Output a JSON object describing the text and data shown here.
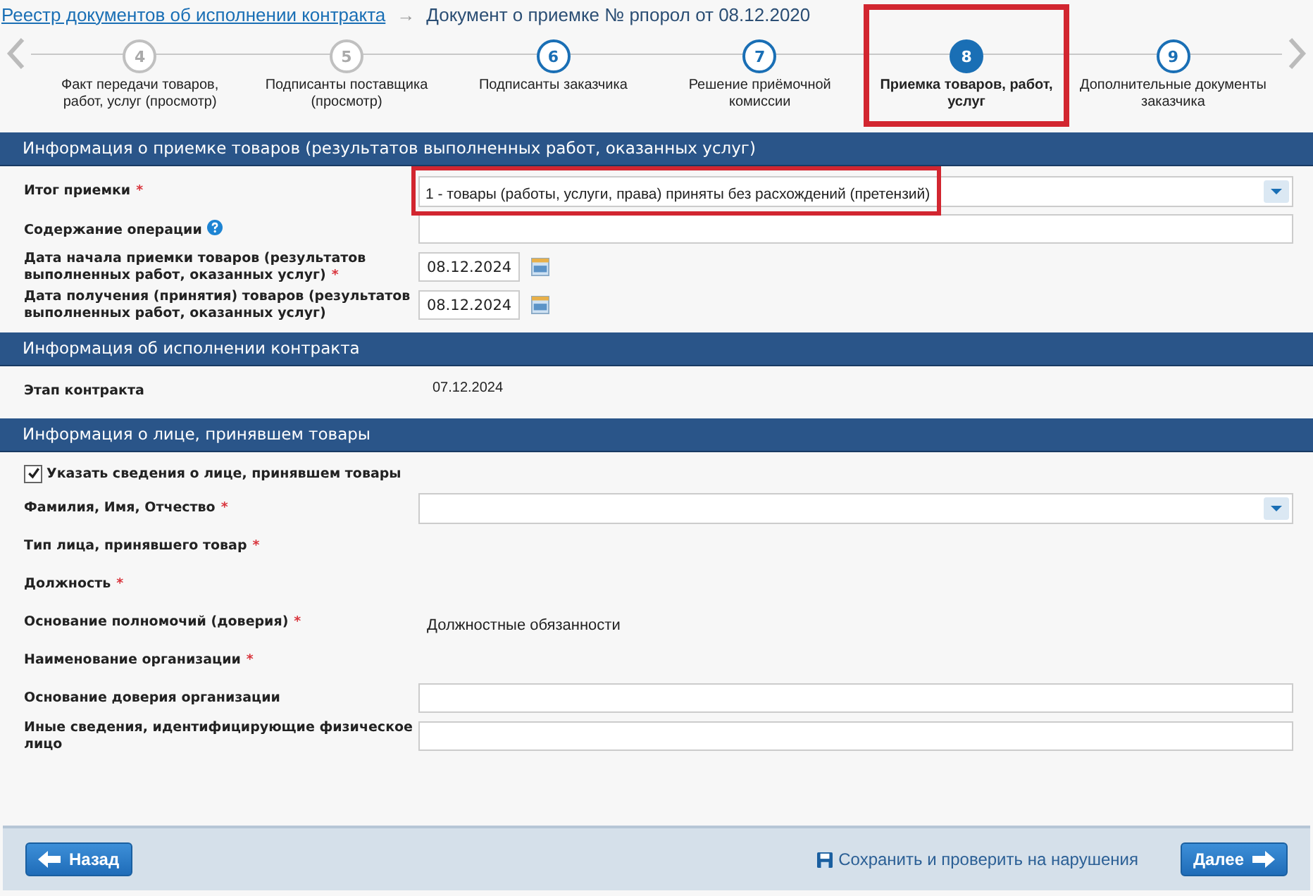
{
  "breadcrumb": {
    "link": "Реестр документов об исполнении контракта",
    "separator": "→",
    "current": "Документ о приемке № рпорол от 08.12.2020"
  },
  "stepper": {
    "steps": [
      {
        "number": "4",
        "label": "Факт передачи товаров, работ, услуг (просмотр)",
        "selected": false,
        "disabled": true,
        "highlighted": false
      },
      {
        "number": "5",
        "label": "Подписанты поставщика (просмотр)",
        "selected": false,
        "disabled": true,
        "highlighted": false
      },
      {
        "number": "6",
        "label": "Подписанты заказчика",
        "selected": false,
        "disabled": false,
        "highlighted": false
      },
      {
        "number": "7",
        "label": "Решение приёмочной комиссии",
        "selected": false,
        "disabled": false,
        "highlighted": false
      },
      {
        "number": "8",
        "label": "Приемка товаров, работ, услуг",
        "selected": true,
        "disabled": false,
        "highlighted": true
      },
      {
        "number": "9",
        "label": "Дополнительные документы заказчика",
        "selected": false,
        "disabled": false,
        "highlighted": false
      }
    ]
  },
  "sections": [
    {
      "title": "Информация о приемке товаров (результатов выполненных работ, оказанных услуг)",
      "rows": [
        {
          "kind": "select",
          "label": "Итог приемки",
          "mark": "*",
          "value": "1 - товары (работы, услуги, права) приняты без расхождений (претензий)",
          "highlighted": true
        },
        {
          "kind": "text",
          "label": "Содержание операции",
          "help": true
        },
        {
          "kind": "date",
          "label": "Дата начала приемки товаров (результатов выполненных работ, оказанных услуг)",
          "mark": "*",
          "value": "08.12.2024"
        },
        {
          "kind": "date",
          "label": "Дата получения (принятия) товаров (результатов выполненных работ, оказанных услуг)",
          "value": "08.12.2024"
        }
      ]
    },
    {
      "title": "Информация об исполнении контракта",
      "rows": [
        {
          "kind": "value",
          "label": "Этап контракта",
          "value": "07.12.2024"
        }
      ]
    },
    {
      "title": "Информация о лице, принявшем товары",
      "rows": [
        {
          "kind": "checkbox",
          "label": "Указать сведения о лице, принявшем товары",
          "checked": true
        },
        {
          "kind": "select",
          "label": "Фамилия, Имя, Отчество",
          "mark": "*"
        },
        {
          "kind": "value",
          "label": "Тип лица, принявшего товар",
          "mark": "*"
        },
        {
          "kind": "value",
          "label": "Должность",
          "mark": "*"
        },
        {
          "kind": "value",
          "label": "Основание полномочий (доверия)",
          "mark": "*",
          "value": "Должностные обязанности"
        },
        {
          "kind": "value",
          "label": "Наименование организации",
          "mark": "*"
        },
        {
          "kind": "text",
          "label": "Основание доверия организации"
        },
        {
          "kind": "text",
          "label": "Иные сведения, идентифицирующие физическое лицо"
        }
      ]
    }
  ],
  "footer": {
    "back": "Назад",
    "save": "Сохранить и проверить на нарушения",
    "next": "Далее"
  }
}
